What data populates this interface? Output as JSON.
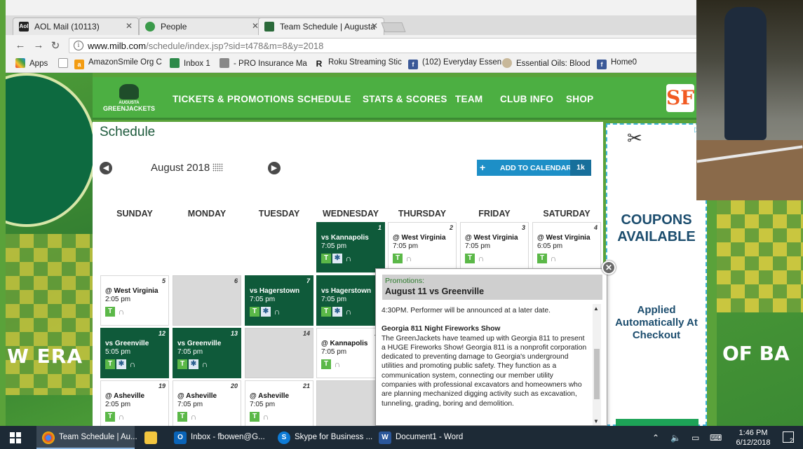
{
  "browser": {
    "tabs": [
      {
        "title": "AOL Mail (10113)",
        "icon": "aol-icon"
      },
      {
        "title": "People",
        "icon": "people-icon"
      },
      {
        "title": "Team Schedule | Augusta",
        "icon": "greenjackets-icon"
      }
    ],
    "url_host": "www.milb.com",
    "url_path": "/schedule/index.jsp?sid=t478&m=8&y=2018",
    "bookmarks": [
      "Apps",
      "AmazonSmile Org C",
      "Inbox 1",
      "- PRO Insurance Ma",
      "Roku Streaming Stic",
      "(102) Everyday Essen",
      "Essential Oils: Blood",
      "Home0"
    ]
  },
  "site": {
    "logo_text": "GREENJACKETS",
    "logo_sub": "AUGUSTA",
    "nav": [
      "TICKETS & PROMOTIONS",
      "SCHEDULE",
      "STATS & SCORES",
      "TEAM",
      "CLUB INFO",
      "SHOP"
    ],
    "affiliate": "SF"
  },
  "background": {
    "left_text": "W ERA",
    "right_text": "OF BA"
  },
  "schedule": {
    "title": "Schedule",
    "month": "August 2018",
    "add_to_calendar": "ADD TO CALENDAR",
    "add_count": "1k",
    "days": [
      "SUNDAY",
      "MONDAY",
      "TUESDAY",
      "WEDNESDAY",
      "THURSDAY",
      "FRIDAY",
      "SATURDAY"
    ],
    "cells": [
      {
        "day": "1",
        "opp": "vs Kannapolis",
        "time": "7:05 pm",
        "home": true,
        "star": true
      },
      {
        "day": "2",
        "opp": "@ West Virginia",
        "time": "7:05 pm",
        "home": false,
        "star": false
      },
      {
        "day": "3",
        "opp": "@ West Virginia",
        "time": "7:05 pm",
        "home": false,
        "star": false
      },
      {
        "day": "4",
        "opp": "@ West Virginia",
        "time": "6:05 pm",
        "home": false,
        "star": false
      },
      {
        "day": "5",
        "opp": "@ West Virginia",
        "time": "2:05 pm",
        "home": false,
        "star": false
      },
      {
        "day": "6",
        "opp": "",
        "time": "",
        "home": false,
        "star": false
      },
      {
        "day": "7",
        "opp": "vs Hagerstown",
        "time": "7:05 pm",
        "home": true,
        "star": true
      },
      {
        "day": "8",
        "opp": "vs Hagerstown",
        "time": "7:05 pm",
        "home": true,
        "star": true
      },
      {
        "day": "12",
        "opp": "vs Greenville",
        "time": "5:05 pm",
        "home": true,
        "star": true
      },
      {
        "day": "13",
        "opp": "vs Greenville",
        "time": "7:05 pm",
        "home": true,
        "star": true
      },
      {
        "day": "14",
        "opp": "",
        "time": "",
        "home": false,
        "star": false
      },
      {
        "day": "15",
        "opp": "@ Kannapolis",
        "time": "7:05 pm",
        "home": false,
        "star": false
      },
      {
        "day": "19",
        "opp": "@ Asheville",
        "time": "2:05 pm",
        "home": false,
        "star": false
      },
      {
        "day": "20",
        "opp": "@ Asheville",
        "time": "7:05 pm",
        "home": false,
        "star": false
      },
      {
        "day": "21",
        "opp": "@ Asheville",
        "time": "7:05 pm",
        "home": false,
        "star": false
      },
      {
        "day": "",
        "opp": "",
        "time": "",
        "home": false,
        "star": false
      }
    ]
  },
  "popup": {
    "label": "Promotions:",
    "title": "August 11 vs Greenville",
    "line1": "4:30PM. Performer will be announced at a later date.",
    "heading": "Georgia 811 Night Fireworks Show",
    "body": "The GreenJackets have teamed up with Georgia 811 to present a HUGE Fireworks Show! Georgia 811 is a nonprofit corporation dedicated to preventing damage to Georgia's underground utilities and promoting public safety. They function as a communication system, connecting our member utility companies with professional excavators and homeowners who are planning mechanized digging activity such as excavation, tunneling, grading, boring and demolition."
  },
  "ad": {
    "coupons": "COUPONS AVAILABLE",
    "applied": "Applied Automatically At Checkout"
  },
  "taskbar": {
    "items": [
      {
        "label": "Team Schedule | Au...",
        "icon": "chrome-icon"
      },
      {
        "label": "",
        "icon": "file-explorer-icon"
      },
      {
        "label": "Inbox - fbowen@G...",
        "icon": "outlook-icon"
      },
      {
        "label": "Skype for Business ...",
        "icon": "skype-icon"
      },
      {
        "label": "Document1 - Word",
        "icon": "word-icon"
      }
    ],
    "time": "1:46 PM",
    "date": "6/12/2018",
    "notifications": "2"
  }
}
